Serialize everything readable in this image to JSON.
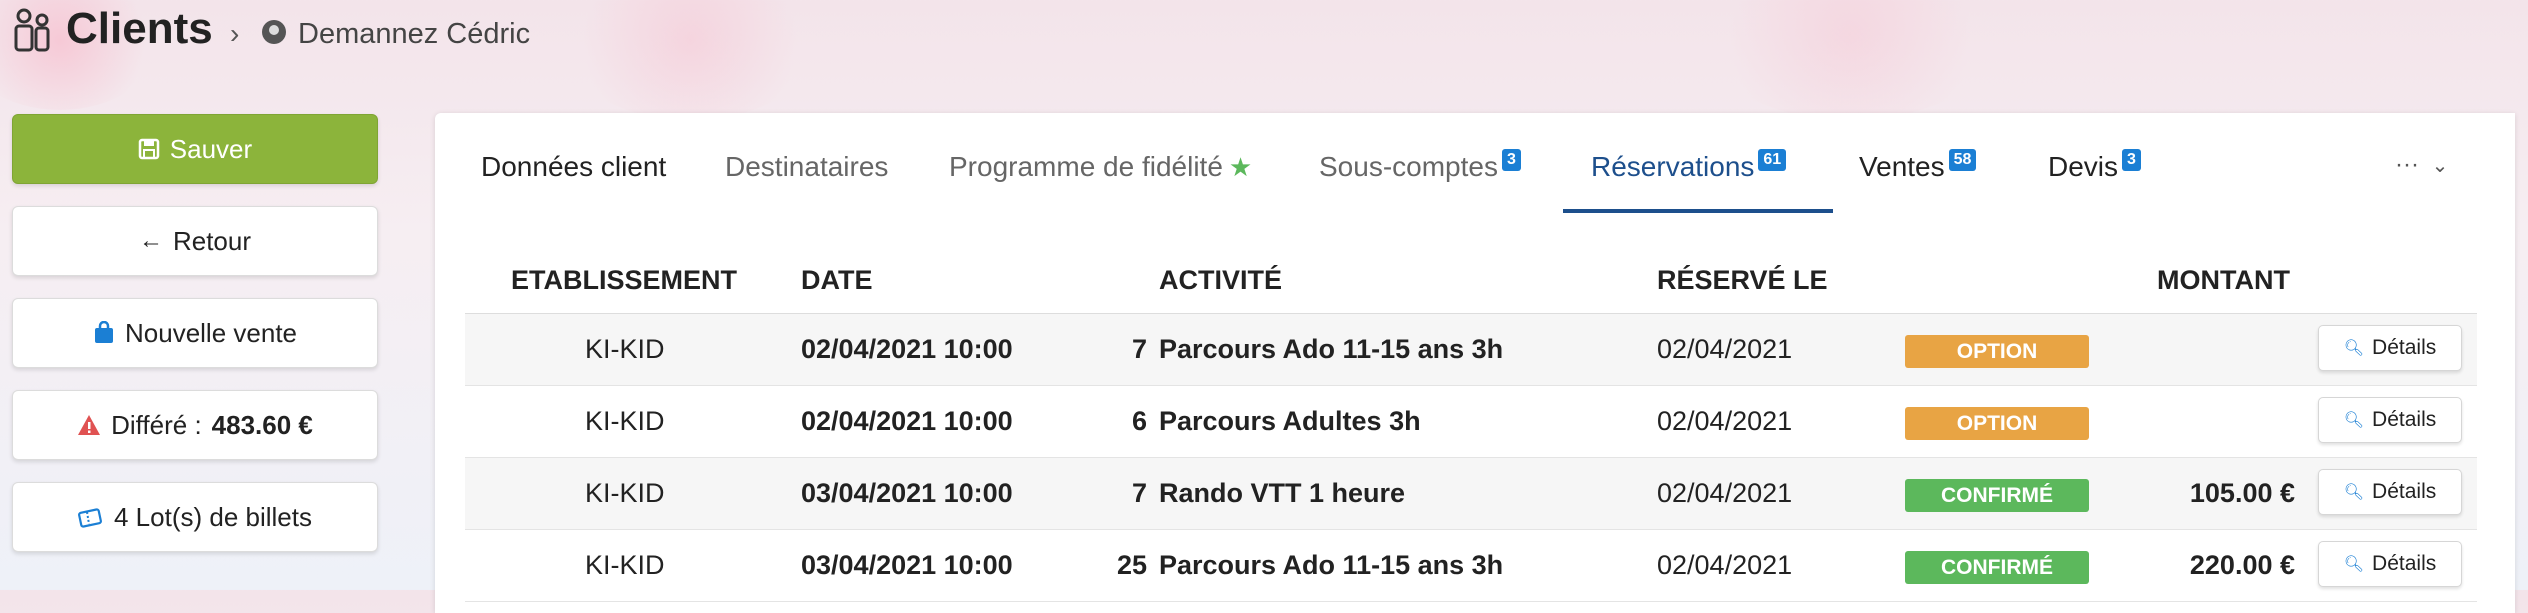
{
  "header": {
    "title": "Clients",
    "breadcrumb_separator": "›",
    "client_name": "Demannez Cédric"
  },
  "sidebar": {
    "save_label": "Sauver",
    "back_label": "Retour",
    "new_sale_label": "Nouvelle vente",
    "deferred_label": "Différé :",
    "deferred_amount": "483.60 €",
    "tickets_label": "4 Lot(s) de billets"
  },
  "tabs": [
    {
      "label": "Données client",
      "badge": ""
    },
    {
      "label": "Destinataires",
      "badge": ""
    },
    {
      "label": "Programme de fidélité",
      "badge": ""
    },
    {
      "label": "Sous-comptes",
      "badge": "3"
    },
    {
      "label": "Réservations",
      "badge": "61"
    },
    {
      "label": "Ventes",
      "badge": "58"
    },
    {
      "label": "Devis",
      "badge": "3"
    }
  ],
  "more_label": "···",
  "table": {
    "headers": [
      "ETABLISSEMENT",
      "DATE",
      "ACTIVITÉ",
      "RÉSERVÉ LE",
      "MONTANT"
    ],
    "details_label": "Détails",
    "rows": [
      {
        "establishment": "KI-KID",
        "date": "02/04/2021 10:00",
        "qty": "7",
        "activity": "Parcours Ado 11-15 ans 3h",
        "reserved_on": "02/04/2021",
        "status": "OPTION",
        "amount": ""
      },
      {
        "establishment": "KI-KID",
        "date": "02/04/2021 10:00",
        "qty": "6",
        "activity": "Parcours Adultes 3h",
        "reserved_on": "02/04/2021",
        "status": "OPTION",
        "amount": ""
      },
      {
        "establishment": "KI-KID",
        "date": "03/04/2021 10:00",
        "qty": "7",
        "activity": "Rando VTT 1 heure",
        "reserved_on": "02/04/2021",
        "status": "CONFIRMÉ",
        "amount": "105.00 €"
      },
      {
        "establishment": "KI-KID",
        "date": "03/04/2021 10:00",
        "qty": "25",
        "activity": "Parcours Ado 11-15 ans 3h",
        "reserved_on": "02/04/2021",
        "status": "CONFIRMÉ",
        "amount": "220.00 €"
      }
    ]
  },
  "colors": {
    "primary_green": "#8cb43b",
    "active_tab": "#1d4f8c",
    "badge_blue": "#1b7fd4",
    "status_option": "#e8a444",
    "status_confirmed": "#5cb85c"
  }
}
